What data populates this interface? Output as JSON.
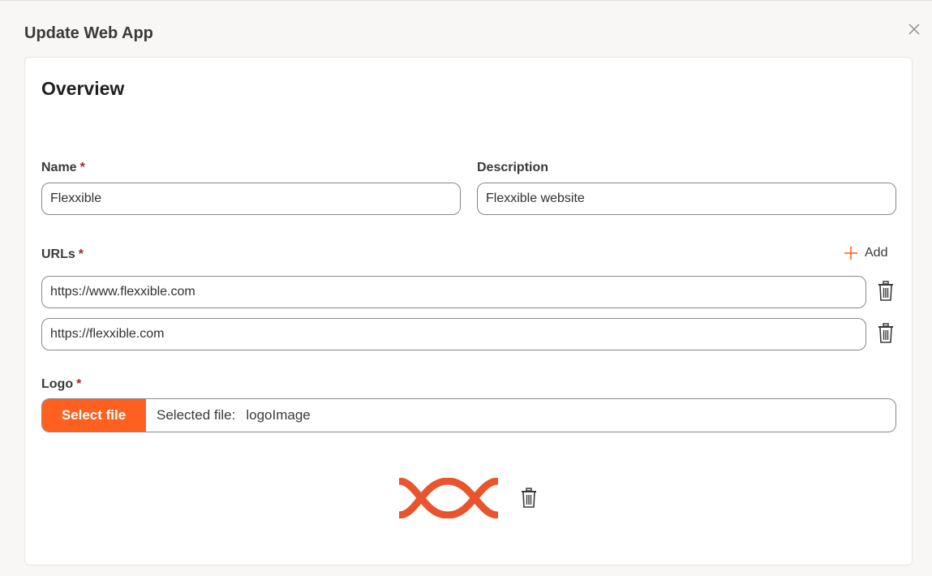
{
  "dialog": {
    "title": "Update Web App",
    "close_icon": "close-icon"
  },
  "overview": {
    "title": "Overview"
  },
  "fields": {
    "name": {
      "label": "Name",
      "required_mark": "*",
      "value": "Flexxible"
    },
    "description": {
      "label": "Description",
      "value": "Flexxible website"
    },
    "urls": {
      "label": "URLs",
      "required_mark": "*",
      "add_label": "Add",
      "add_icon": "plus-icon",
      "delete_icon": "trash-icon",
      "items": [
        {
          "value": "https://www.flexxible.com"
        },
        {
          "value": "https://flexxible.com"
        }
      ]
    },
    "logo": {
      "label": "Logo",
      "required_mark": "*",
      "select_button_label": "Select file",
      "selected_prefix": "Selected file:",
      "selected_name": "logoImage",
      "preview_icon": "flexxible-logo",
      "delete_icon": "trash-icon"
    }
  },
  "colors": {
    "accent": "#ff5f1f",
    "logo": "#e8542d",
    "required": "#a4262c"
  }
}
